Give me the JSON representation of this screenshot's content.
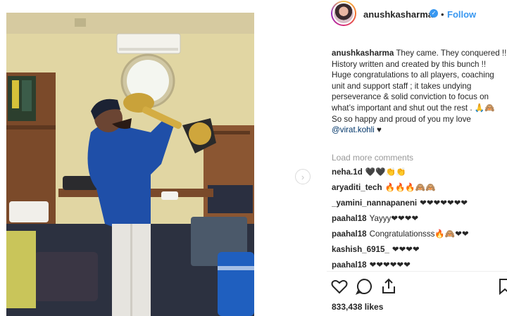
{
  "header": {
    "username": "anushkasharma",
    "verified_icon": "verified-badge-icon",
    "separator": "•",
    "follow_label": "Follow"
  },
  "caption": {
    "username": "anushkasharma",
    "line1": "They came. They conquered !!",
    "line2": "History written and created by this bunch !! Huge congratulations to all players, coaching unit and support staff ; it takes undying perseverance & solid conviction to focus on what’s important and shut out the rest .",
    "emoji_tail": "🙏🙈 So so happy and proud of you my love ",
    "mention": "@virat.kohli",
    "heart": "♥"
  },
  "load_more": "Load more comments",
  "comments": [
    {
      "user": "neha.1d",
      "text": "🖤🖤👏👏"
    },
    {
      "user": "aryaditi_tech",
      "text": "🔥🔥🔥🙈🙈"
    },
    {
      "user": "_yamini_nannapaneni",
      "text": "❤❤❤❤❤❤❤"
    },
    {
      "user": "paahal18",
      "text": "Yayyy❤❤❤❤"
    },
    {
      "user": "paahal18",
      "text": "Congratulationsss🔥🙈❤❤"
    },
    {
      "user": "kashish_6915_",
      "text": "❤❤❤❤"
    },
    {
      "user": "paahal18",
      "text": "❤❤❤❤❤❤"
    }
  ],
  "actions": {
    "like_icon": "heart-icon",
    "comment_icon": "comment-icon",
    "share_icon": "share-icon",
    "save_icon": "bookmark-icon"
  },
  "likes": "833,438 likes",
  "nav": {
    "next_icon": "chevron-right-icon",
    "next_glyph": "›"
  },
  "colors": {
    "link": "#3897f0",
    "text": "#262626",
    "muted": "#999999",
    "mention": "#003569"
  }
}
